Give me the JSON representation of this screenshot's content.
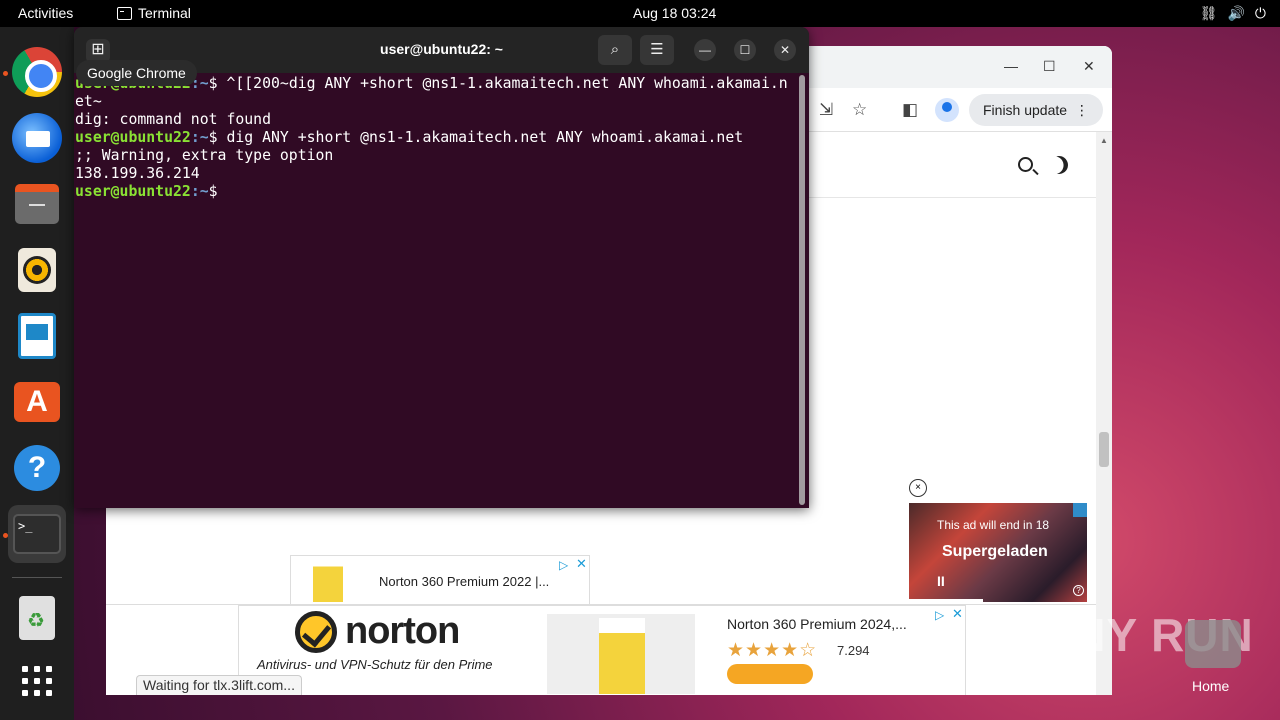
{
  "topbar": {
    "activities": "Activities",
    "app_name": "Terminal",
    "clock": "Aug 18  03:24",
    "tray_icons": [
      "network-icon",
      "volume-icon",
      "power-icon"
    ]
  },
  "dock": {
    "tooltip": "Google Chrome",
    "items": [
      "chrome",
      "thunderbird",
      "files",
      "rhythmbox",
      "libreoffice-writer",
      "app-center",
      "help",
      "terminal",
      "trash",
      "show-apps"
    ]
  },
  "chrome": {
    "finish_update": "Finish update",
    "status": "Waiting for tlx.3lift.com...",
    "video_ad": {
      "note": "This ad will end in 18",
      "headline": "Supergeladen",
      "pause": "II"
    },
    "ad_small": {
      "title": "Norton 360 Premium 2022 |..."
    },
    "ad_banner": {
      "logo": "norton",
      "tagline": "Antivirus- und VPN-Schutz für den Prime",
      "title": "Norton 360 Premium 2024,...",
      "stars": "★★★★☆",
      "rating": "7.294"
    }
  },
  "terminal": {
    "title": "user@ubuntu22: ~",
    "lines": [
      {
        "user": "user@ubuntu22",
        "path": ":~",
        "text": "$ ^[[200~dig ANY +short @ns1-1.akamaitech.net ANY whoami.akamai.n"
      },
      {
        "text": "et~"
      },
      {
        "text": "dig: command not found"
      },
      {
        "user": "user@ubuntu22",
        "path": ":~",
        "text": "$ dig ANY +short @ns1-1.akamaitech.net ANY whoami.akamai.net"
      },
      {
        "text": ";; Warning, extra type option"
      },
      {
        "text": "138.199.36.214"
      },
      {
        "user": "user@ubuntu22",
        "path": ":~",
        "text": "$ "
      }
    ]
  },
  "watermark": {
    "text": "ANY RUN",
    "home_label": "Home"
  }
}
